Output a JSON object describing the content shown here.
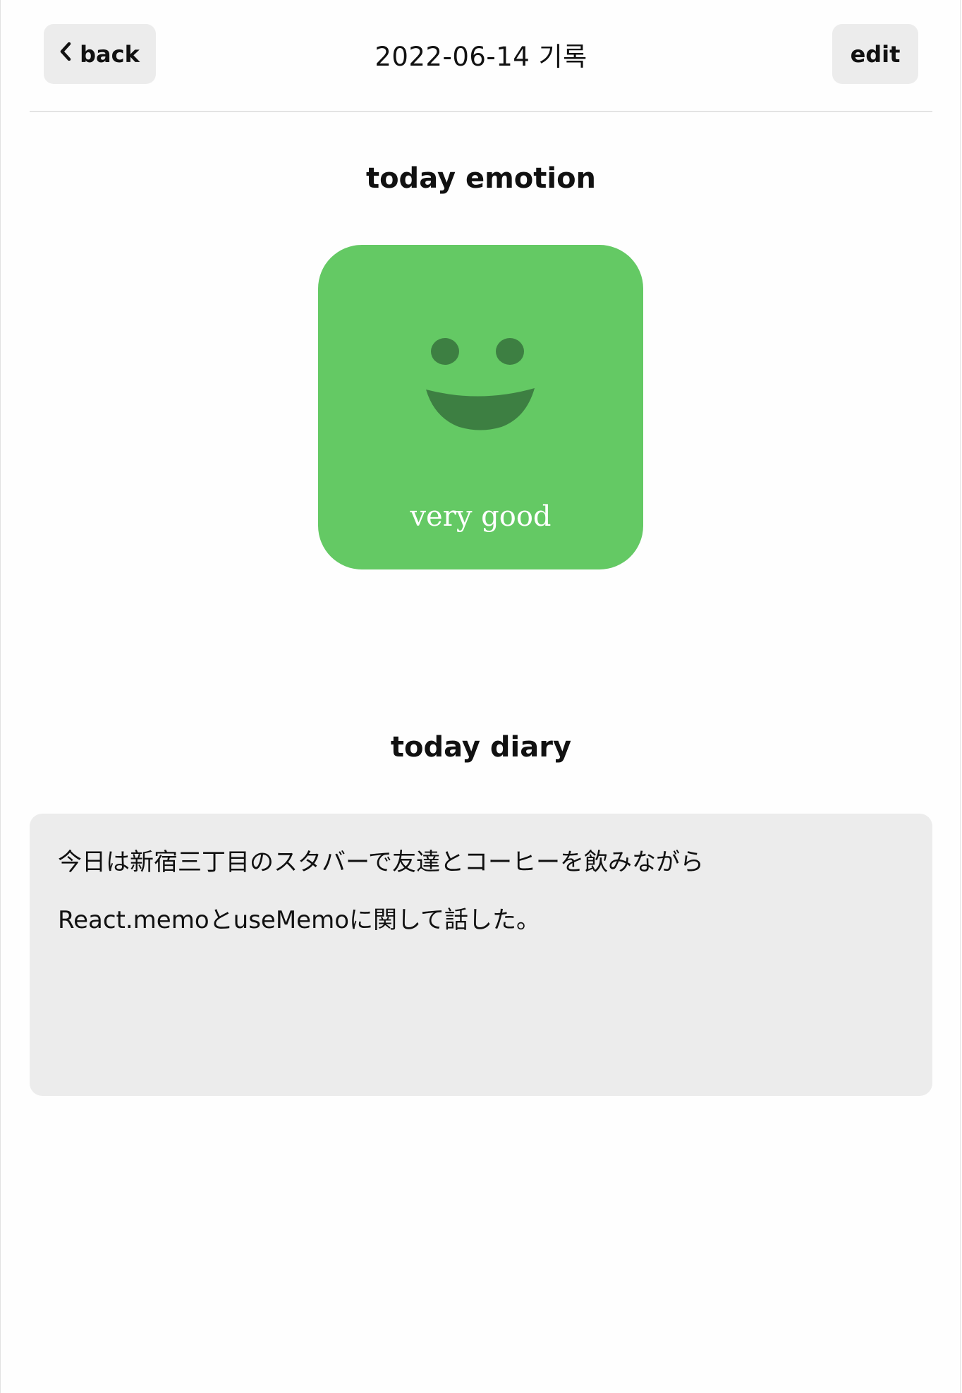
{
  "header": {
    "back_label": "back",
    "title": "2022-06-14 기록",
    "edit_label": "edit"
  },
  "emotion": {
    "section_title": "today emotion",
    "label": "very good",
    "icon": "smile-face-icon",
    "card_color": "#64c964",
    "face_color": "#3d7f42"
  },
  "diary": {
    "section_title": "today diary",
    "lines": [
      "今日は新宿三丁目のスタバーで友達とコーヒーを飲みながら",
      "React.memoとuseMemoに関して話した。"
    ],
    "box_color": "#ececec"
  }
}
